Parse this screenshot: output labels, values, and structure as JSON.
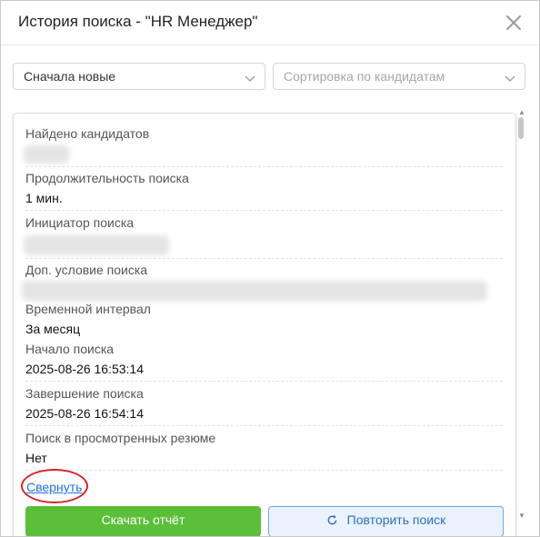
{
  "dialog": {
    "title": "История поиска - \"HR Менеджер\""
  },
  "filters": {
    "sort_order": {
      "value": "Сначала новые"
    },
    "candidate_sort": {
      "placeholder": "Сортировка по кандидатам"
    }
  },
  "details": {
    "found": {
      "label": "Найдено кандидатов",
      "value": ""
    },
    "duration": {
      "label": "Продолжительность поиска",
      "value": "1 мин."
    },
    "initiator": {
      "label": "Инициатор поиска",
      "value": ""
    },
    "extra_condition": {
      "label": "Доп. условие поиска",
      "value": ""
    },
    "time_interval": {
      "label": "Временной интервал",
      "value": "За месяц"
    },
    "start": {
      "label": "Начало поиска",
      "value": "2025-08-26 16:53:14"
    },
    "end": {
      "label": "Завершение поиска",
      "value": "2025-08-26 16:54:14"
    },
    "viewed_resumes": {
      "label": "Поиск в просмотренных резюме",
      "value": "Нет"
    }
  },
  "actions": {
    "collapse": "Свернуть",
    "download": "Скачать отчёт",
    "repeat": "Повторить поиск"
  },
  "colors": {
    "accent_link": "#1a73e8",
    "download_button": "#5cbf3a",
    "repeat_button_border": "#6aa8e8",
    "annotation": "#d8222a"
  }
}
